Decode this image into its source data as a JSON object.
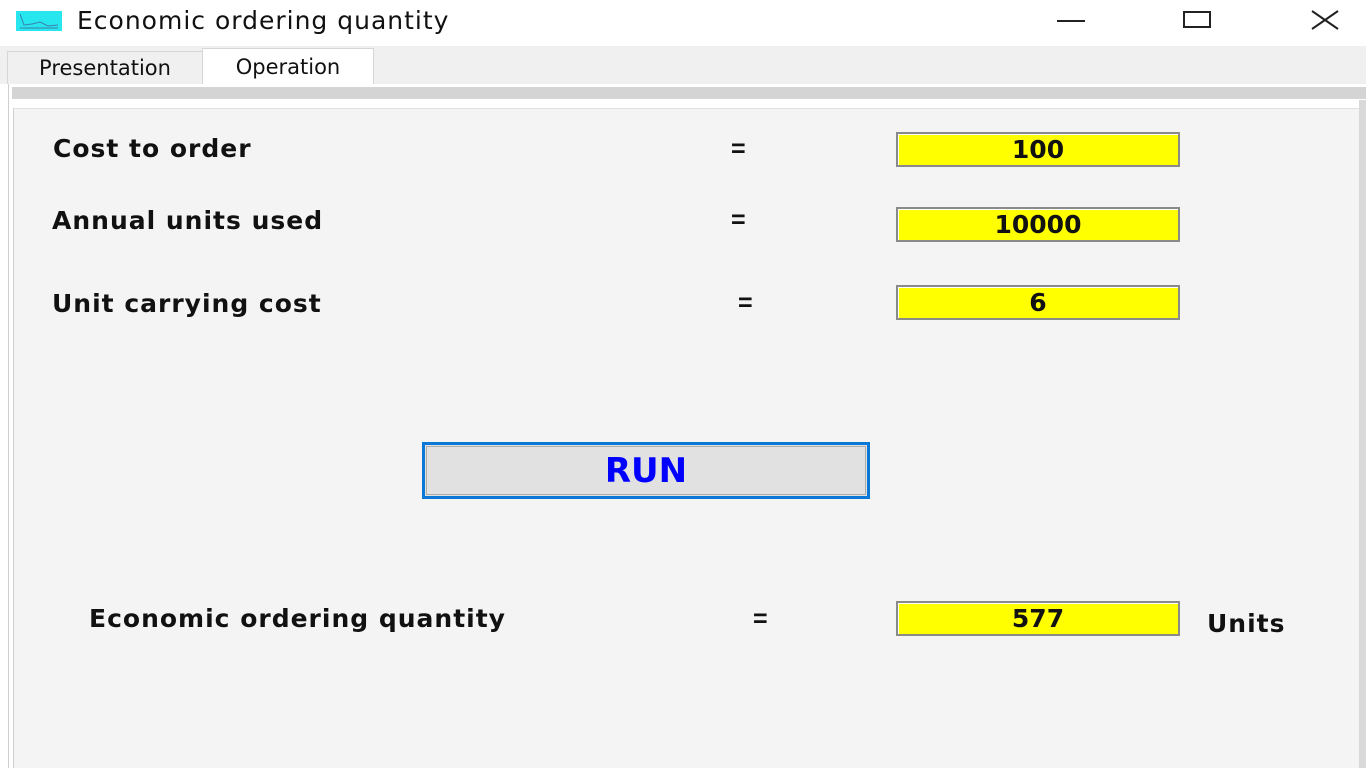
{
  "window": {
    "title": "Economic ordering quantity",
    "icon": "chart-app-icon",
    "controls": {
      "minimize": "minimize-icon",
      "maximize": "maximize-icon",
      "close": "close-icon"
    }
  },
  "tabs": [
    {
      "label": "Presentation",
      "active": false
    },
    {
      "label": "Operation",
      "active": true
    }
  ],
  "form": {
    "rows": [
      {
        "label": "Cost to order",
        "equals": "=",
        "value": "100"
      },
      {
        "label": "Annual units used",
        "equals": "=",
        "value": "10000"
      },
      {
        "label": "Unit carrying cost",
        "equals": "=",
        "value": "6"
      }
    ],
    "run_label": "RUN",
    "result": {
      "label": "Economic ordering quantity",
      "equals": "=",
      "value": "577",
      "unit": "Units"
    }
  },
  "colors": {
    "field_bg": "#ffff00",
    "run_text": "#0000ff",
    "run_border": "#0a78d7",
    "icon_bg": "#27e6ee"
  }
}
